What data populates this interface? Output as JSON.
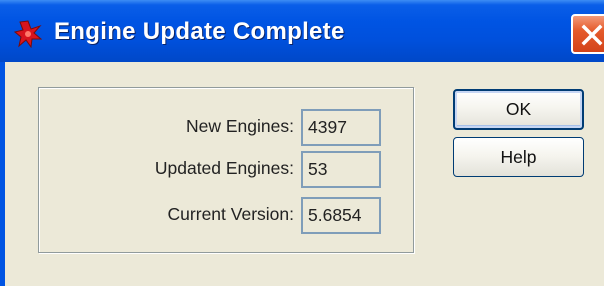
{
  "window": {
    "title": "Engine Update Complete",
    "title_icon": "red-star-icon",
    "close_icon": "close-icon"
  },
  "fields": {
    "new_engines": {
      "label": "New Engines:",
      "value": "4397"
    },
    "updated_engines": {
      "label": "Updated Engines:",
      "value": "53"
    },
    "current_version": {
      "label": "Current Version:",
      "value": "5.6854"
    }
  },
  "buttons": {
    "ok": "OK",
    "help": "Help"
  },
  "colors": {
    "title_bar": "#0054e3",
    "dialog_bg": "#ece9d8",
    "close_button": "#e55b2c",
    "field_border": "#7f9db9"
  }
}
